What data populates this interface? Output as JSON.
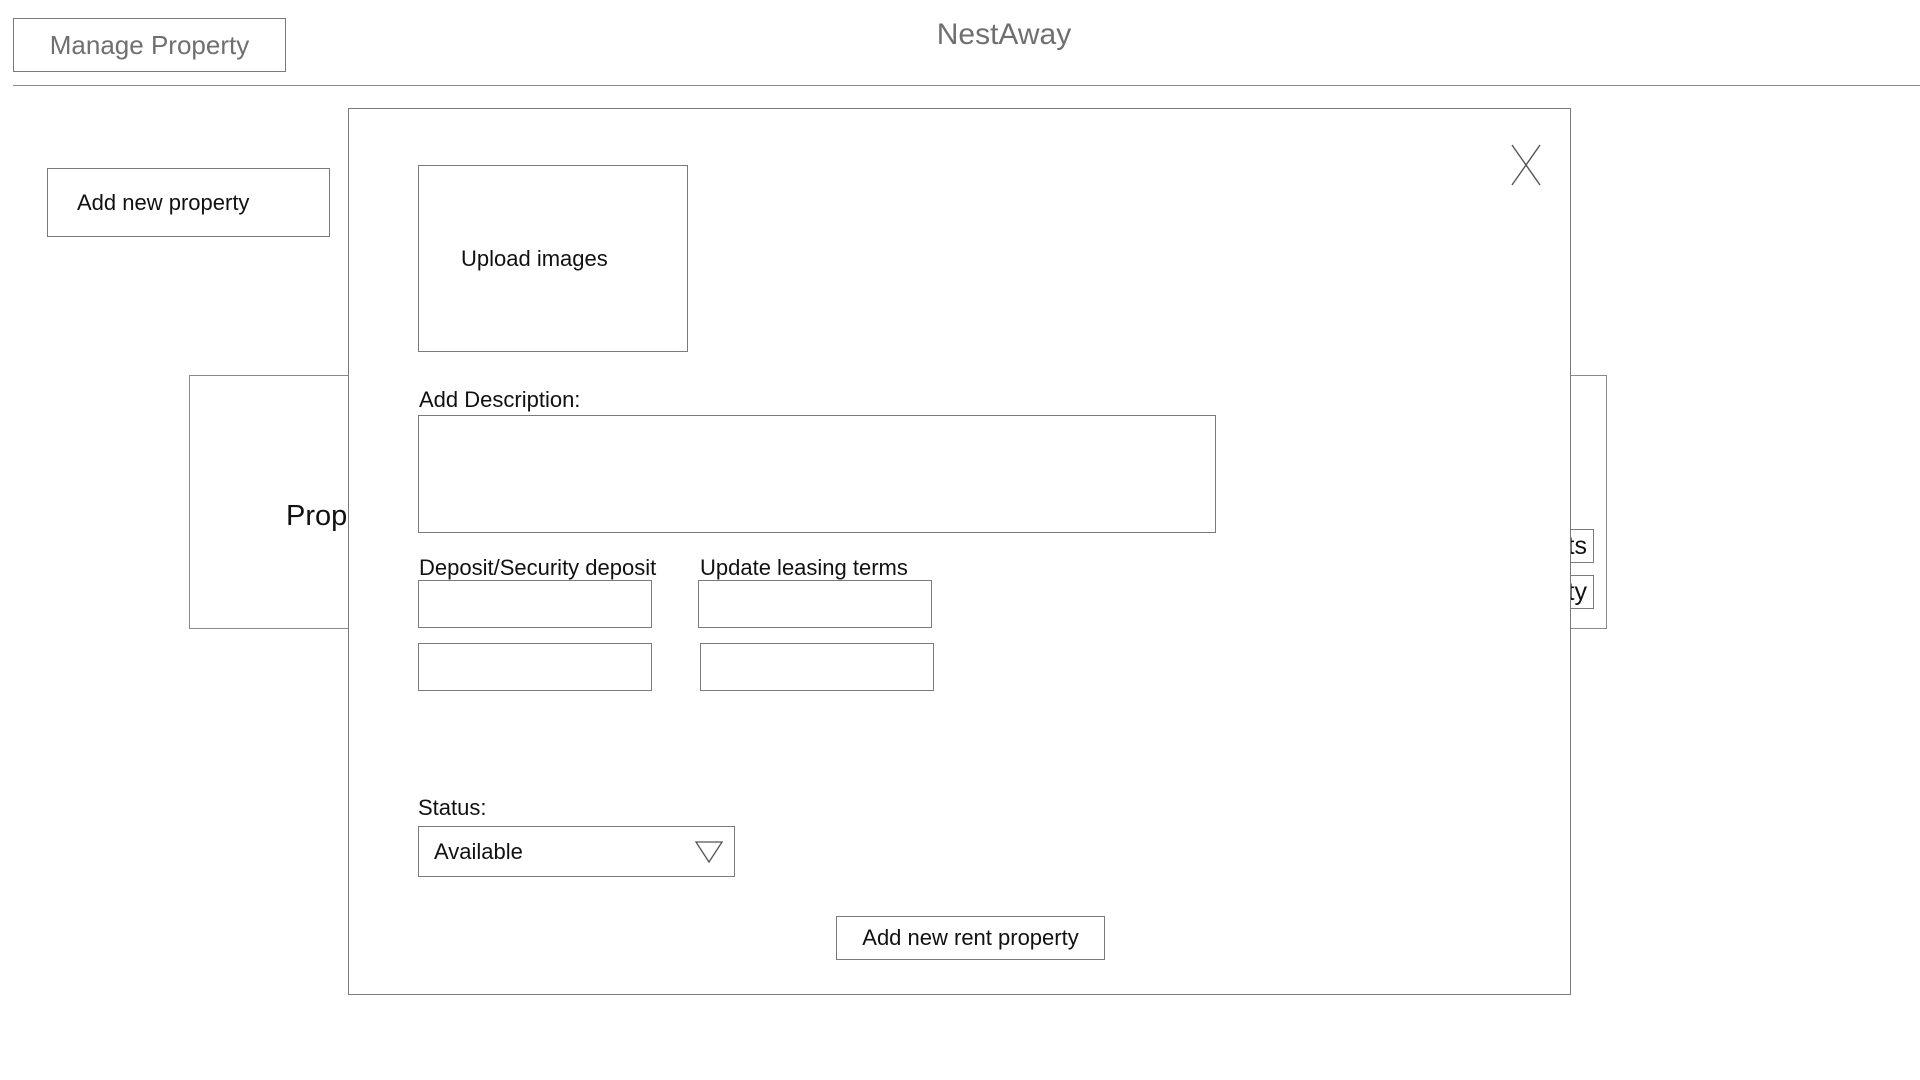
{
  "header": {
    "manage_label": "Manage Property",
    "app_title": "NestAway"
  },
  "background": {
    "add_property_label": "Add new property",
    "card_title_partial": "Prop",
    "card_button_1_partial": "ts",
    "card_button_2_partial": "ty"
  },
  "modal": {
    "close_icon": "close-icon",
    "upload_label": "Upload images",
    "description_label": "Add Description:",
    "description_value": "",
    "deposit_label": "Deposit/Security deposit",
    "leasing_label": "Update leasing terms",
    "deposit_field_1": "",
    "deposit_field_2": "",
    "leasing_field_1": "",
    "leasing_field_2": "",
    "status_label": "Status:",
    "status_value": "Available",
    "dropdown_icon": "triangle-down-icon",
    "submit_label": "Add new rent property"
  }
}
